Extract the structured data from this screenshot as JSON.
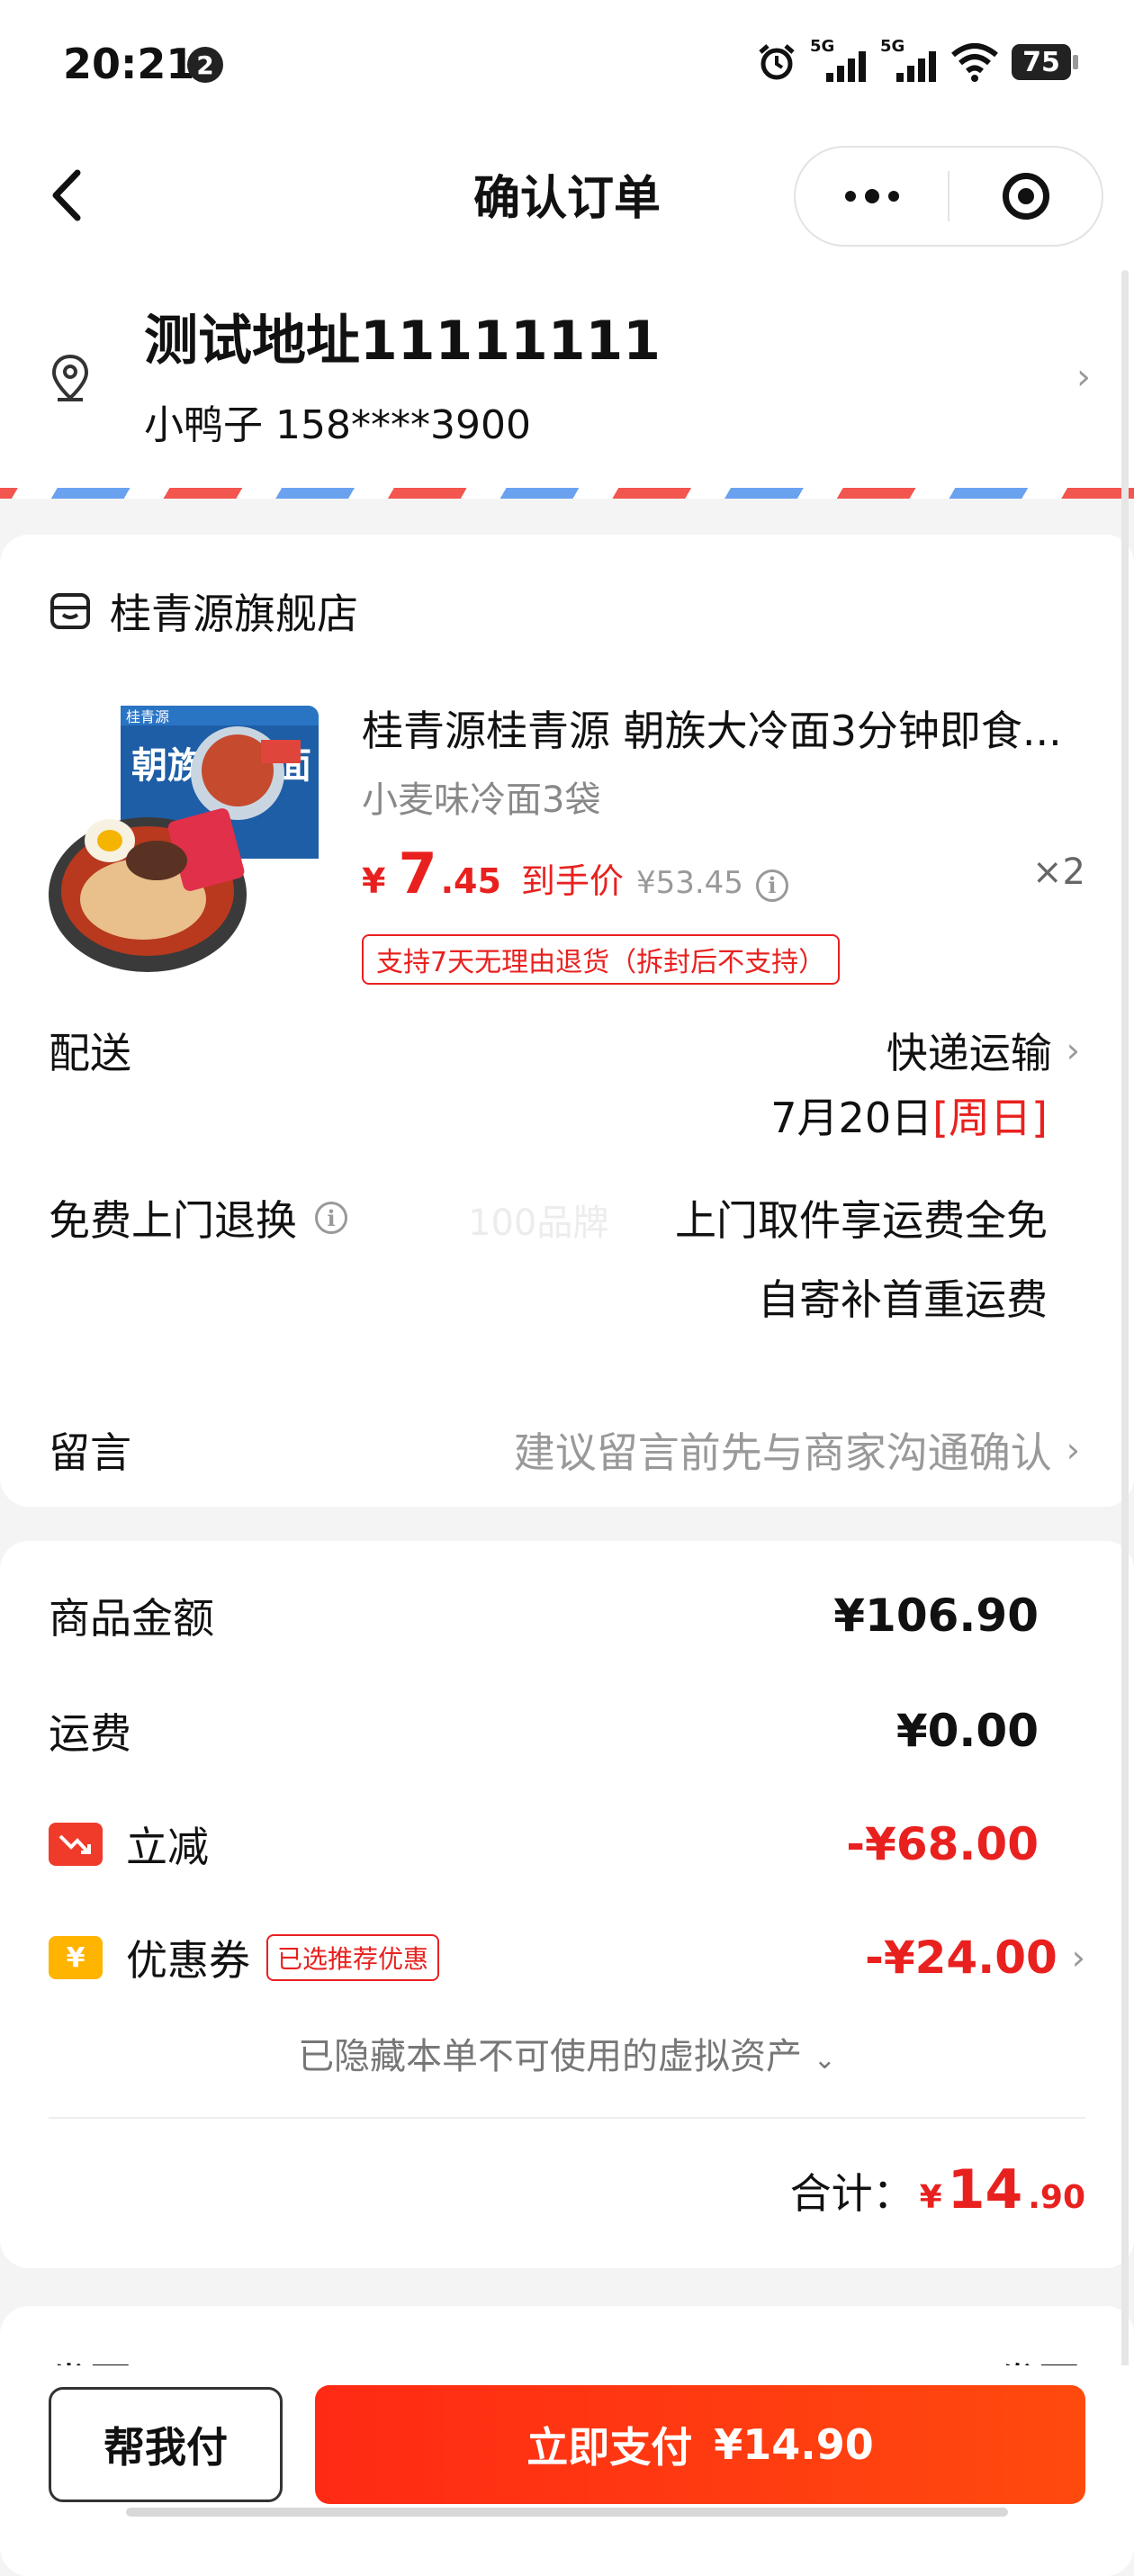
{
  "status_bar": {
    "time": "20:21",
    "notification_count": "2",
    "network_1": "5G",
    "network_2": "5G",
    "battery": "75"
  },
  "nav": {
    "title": "确认订单"
  },
  "address": {
    "line": "测试地址11111111",
    "recipient": "小鸭子 158****3900"
  },
  "store": {
    "name": "桂青源旗舰店"
  },
  "product": {
    "thumb_brand": "桂青源",
    "thumb_title": "朝族大冷面",
    "title": "桂青源桂青源 朝族大冷面3分钟即食...",
    "spec": "小麦味冷面3袋",
    "price_yen": "¥",
    "price_int": "7",
    "price_dec": ".45",
    "price_label": "到手价",
    "original_price": "¥53.45",
    "quantity": "×2",
    "return_policy": "支持7天无理由退货（拆封后不支持）"
  },
  "delivery": {
    "label": "配送",
    "method": "快递运输",
    "date": "7月20日",
    "weekday": "[周日]"
  },
  "free_return": {
    "label": "免费上门退换",
    "watermark": "100品牌",
    "line1": "上门取件享运费全免",
    "line2": "自寄补首重运费"
  },
  "note": {
    "label": "留言",
    "placeholder": "建议留言前先与商家沟通确认"
  },
  "amounts": {
    "goods_label": "商品金额",
    "goods_value": "¥106.90",
    "shipping_label": "运费",
    "shipping_value": "¥0.00",
    "discount_label": "立减",
    "discount_value": "-¥68.00",
    "coupon_label": "优惠券",
    "coupon_tag": "已选推荐优惠",
    "coupon_value": "-¥24.00",
    "hidden_assets": "已隐藏本单不可使用的虚拟资产",
    "total_label": "合计：",
    "total_yen": "¥",
    "total_int": "14",
    "total_dec": ".90"
  },
  "invoice": {
    "label": "发票",
    "value": "不开发票"
  },
  "bottom": {
    "help_label": "帮我付",
    "pay_label": "立即支付",
    "pay_amount": "¥14.90"
  },
  "colors": {
    "accent": "#e8211f",
    "pay_button": "#ff3210",
    "coupon_icon": "#ffb400"
  }
}
